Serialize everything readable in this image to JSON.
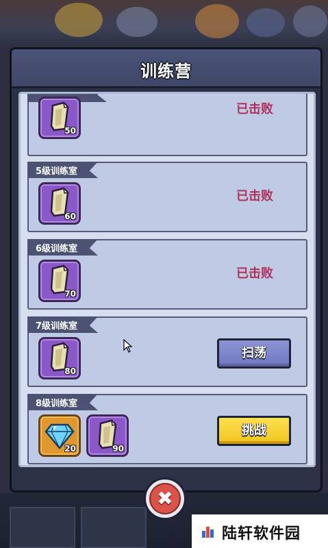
{
  "modal": {
    "title": "训练营"
  },
  "rooms": [
    {
      "label": "",
      "status": "已击败",
      "rewards": [
        {
          "icon": "scroll-icon",
          "count": "50"
        }
      ]
    },
    {
      "label": "5级训练室",
      "status": "已击败",
      "rewards": [
        {
          "icon": "scroll-icon",
          "count": "60"
        }
      ]
    },
    {
      "label": "6级训练室",
      "status": "已击败",
      "rewards": [
        {
          "icon": "scroll-icon",
          "count": "70"
        }
      ]
    },
    {
      "label": "7级训练室",
      "button": "扫荡",
      "rewards": [
        {
          "icon": "scroll-icon",
          "count": "80"
        }
      ]
    },
    {
      "label": "8级训练室",
      "button": "挑战",
      "rewards": [
        {
          "icon": "diamond-icon",
          "count": "20"
        },
        {
          "icon": "scroll-icon",
          "count": "90"
        }
      ]
    }
  ],
  "close_button": {
    "icon": "close-icon"
  },
  "watermark": {
    "text": "陆轩软件园"
  },
  "colors": {
    "defeated": "#b0305c",
    "sweep_button": "#7b83ca",
    "challenge_button": "#f6d133",
    "purple_slot": "#8a58c8",
    "gold_slot": "#e0972e"
  }
}
